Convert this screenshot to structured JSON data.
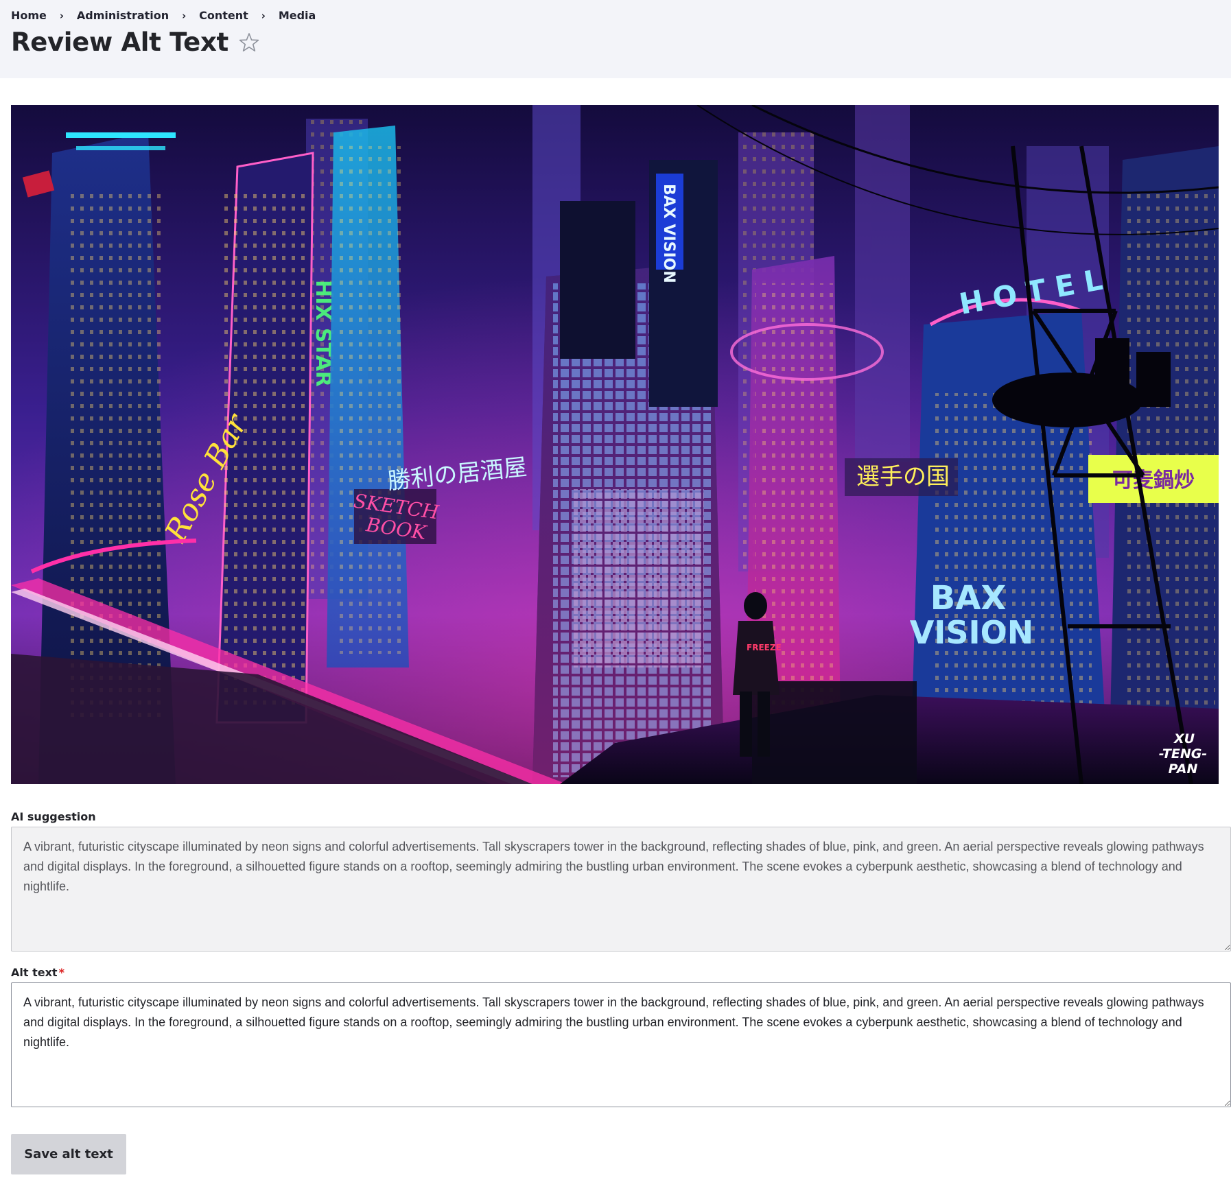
{
  "breadcrumb": {
    "items": [
      "Home",
      "Administration",
      "Content",
      "Media"
    ],
    "separator": "›"
  },
  "page": {
    "title": "Review Alt Text",
    "favorite_icon": "star-outline-icon"
  },
  "image": {
    "signs": {
      "bax_vision": "BAX\nVISION",
      "hotel": "HOTEL",
      "rose_bar": "Rose Bar",
      "sketch_book": "SKETCH\nBOOK",
      "izakaya": "勝利の居酒屋",
      "country": "選手の国",
      "watermark": "XU\n-TENG-\nPAN"
    }
  },
  "form": {
    "ai_suggestion": {
      "label": "AI suggestion",
      "value": "A vibrant, futuristic cityscape illuminated by neon signs and colorful advertisements. Tall skyscrapers tower in the background, reflecting shades of blue, pink, and green. An aerial perspective reveals glowing pathways and digital displays. In the foreground, a silhouetted figure stands on a rooftop, seemingly admiring the bustling urban environment. The scene evokes a cyberpunk aesthetic, showcasing a blend of technology and nightlife."
    },
    "alt_text": {
      "label": "Alt text",
      "required_marker": "*",
      "value": "A vibrant, futuristic cityscape illuminated by neon signs and colorful advertisements. Tall skyscrapers tower in the background, reflecting shades of blue, pink, and green. An aerial perspective reveals glowing pathways and digital displays. In the foreground, a silhouetted figure stands on a rooftop, seemingly admiring the bustling urban environment. The scene evokes a cyberpunk aesthetic, showcasing a blend of technology and nightlife."
    },
    "save_label": "Save alt text"
  },
  "colors": {
    "header_bg": "#f3f4f9",
    "required": "#dc2323",
    "button_bg": "#d3d4d9",
    "neon_pink": "#ff2fa8",
    "neon_cyan": "#2ee6ff",
    "neon_purple": "#9b4dff"
  }
}
